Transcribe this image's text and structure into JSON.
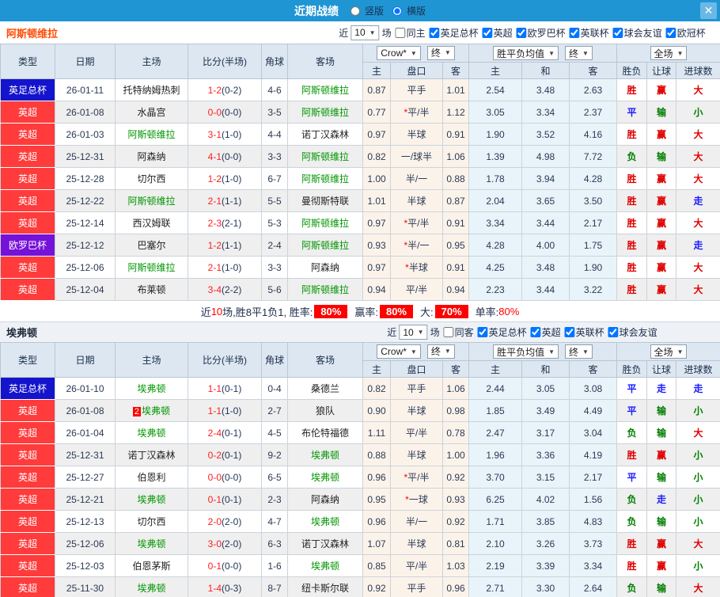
{
  "titlebar": {
    "title": "近期战绩",
    "radio_vertical": "竖版",
    "radio_horizontal": "横版",
    "close": "✕"
  },
  "table_header": {
    "type": "类型",
    "date": "日期",
    "home": "主场",
    "score": "比分(半场)",
    "corner": "角球",
    "away": "客场",
    "odds_select": "Crow*",
    "final_select": "终",
    "avg_select": "胜平负均值",
    "final_select2": "终",
    "scope_select": "全场",
    "sub_home": "主",
    "sub_handicap": "盘口",
    "sub_away": "客",
    "sub_win": "主",
    "sub_draw": "和",
    "sub_lose": "客",
    "sub_result": "胜负",
    "sub_hcp": "让球",
    "sub_goals": "进球数"
  },
  "competition_colors": {
    "英足总杯": "#1414cc",
    "英超": "#ff3b3b",
    "欧罗巴杯": "#7611d8"
  },
  "result_colors": {
    "胜": "#e00000",
    "平": "#1a1aff",
    "负": "#007d00",
    "赢": "#e00000",
    "走": "#1a1aff",
    "输": "#007d00",
    "大": "#e00000",
    "小": "#007d00"
  },
  "sections": [
    {
      "team": "阿斯顿维拉",
      "filter": {
        "near_label": "近",
        "count_value": "10",
        "games_label": "场",
        "venue_label": "同主",
        "venue_checked": false,
        "competitions": [
          "英足总杯",
          "英超",
          "欧罗巴杯",
          "英联杯",
          "球会友谊",
          "欧冠杯"
        ]
      },
      "rows": [
        {
          "comp": "英足总杯",
          "date": "26-01-11",
          "home": "托特纳姆热刺",
          "home_team": false,
          "badge": "",
          "score": "1-2",
          "half": "(0-2)",
          "corner": "4-6",
          "away": "阿斯顿维拉",
          "away_team": true,
          "h": "0.87",
          "hcp": "平手",
          "a": "1.01",
          "w": "2.54",
          "d": "3.48",
          "l": "2.63",
          "r1": "胜",
          "r2": "赢",
          "r3": "大"
        },
        {
          "comp": "英超",
          "date": "26-01-08",
          "home": "水晶宫",
          "home_team": false,
          "badge": "",
          "score": "0-0",
          "half": "(0-0)",
          "corner": "3-5",
          "away": "阿斯顿维拉",
          "away_team": true,
          "h": "0.77",
          "hcp": "*平/半",
          "a": "1.12",
          "w": "3.05",
          "d": "3.34",
          "l": "2.37",
          "r1": "平",
          "r2": "输",
          "r3": "小"
        },
        {
          "comp": "英超",
          "date": "26-01-03",
          "home": "阿斯顿维拉",
          "home_team": true,
          "badge": "",
          "score": "3-1",
          "half": "(1-0)",
          "corner": "4-4",
          "away": "诺丁汉森林",
          "away_team": false,
          "h": "0.97",
          "hcp": "半球",
          "a": "0.91",
          "w": "1.90",
          "d": "3.52",
          "l": "4.16",
          "r1": "胜",
          "r2": "赢",
          "r3": "大"
        },
        {
          "comp": "英超",
          "date": "25-12-31",
          "home": "阿森纳",
          "home_team": false,
          "badge": "",
          "score": "4-1",
          "half": "(0-0)",
          "corner": "3-3",
          "away": "阿斯顿维拉",
          "away_team": true,
          "h": "0.82",
          "hcp": "一/球半",
          "a": "1.06",
          "w": "1.39",
          "d": "4.98",
          "l": "7.72",
          "r1": "负",
          "r2": "输",
          "r3": "大"
        },
        {
          "comp": "英超",
          "date": "25-12-28",
          "home": "切尔西",
          "home_team": false,
          "badge": "",
          "score": "1-2",
          "half": "(1-0)",
          "corner": "6-7",
          "away": "阿斯顿维拉",
          "away_team": true,
          "h": "1.00",
          "hcp": "半/一",
          "a": "0.88",
          "w": "1.78",
          "d": "3.94",
          "l": "4.28",
          "r1": "胜",
          "r2": "赢",
          "r3": "大"
        },
        {
          "comp": "英超",
          "date": "25-12-22",
          "home": "阿斯顿维拉",
          "home_team": true,
          "badge": "",
          "score": "2-1",
          "half": "(1-1)",
          "corner": "5-5",
          "away": "曼彻斯特联",
          "away_team": false,
          "h": "1.01",
          "hcp": "半球",
          "a": "0.87",
          "w": "2.04",
          "d": "3.65",
          "l": "3.50",
          "r1": "胜",
          "r2": "赢",
          "r3": "走"
        },
        {
          "comp": "英超",
          "date": "25-12-14",
          "home": "西汉姆联",
          "home_team": false,
          "badge": "",
          "score": "2-3",
          "half": "(2-1)",
          "corner": "5-3",
          "away": "阿斯顿维拉",
          "away_team": true,
          "h": "0.97",
          "hcp": "*平/半",
          "a": "0.91",
          "w": "3.34",
          "d": "3.44",
          "l": "2.17",
          "r1": "胜",
          "r2": "赢",
          "r3": "大"
        },
        {
          "comp": "欧罗巴杯",
          "date": "25-12-12",
          "home": "巴塞尔",
          "home_team": false,
          "badge": "",
          "score": "1-2",
          "half": "(1-1)",
          "corner": "2-4",
          "away": "阿斯顿维拉",
          "away_team": true,
          "h": "0.93",
          "hcp": "*半/一",
          "a": "0.95",
          "w": "4.28",
          "d": "4.00",
          "l": "1.75",
          "r1": "胜",
          "r2": "赢",
          "r3": "走"
        },
        {
          "comp": "英超",
          "date": "25-12-06",
          "home": "阿斯顿维拉",
          "home_team": true,
          "badge": "",
          "score": "2-1",
          "half": "(1-0)",
          "corner": "3-3",
          "away": "阿森纳",
          "away_team": false,
          "h": "0.97",
          "hcp": "*半球",
          "a": "0.91",
          "w": "4.25",
          "d": "3.48",
          "l": "1.90",
          "r1": "胜",
          "r2": "赢",
          "r3": "大"
        },
        {
          "comp": "英超",
          "date": "25-12-04",
          "home": "布莱顿",
          "home_team": false,
          "badge": "",
          "score": "3-4",
          "half": "(2-2)",
          "corner": "5-6",
          "away": "阿斯顿维拉",
          "away_team": true,
          "h": "0.94",
          "hcp": "平/半",
          "a": "0.94",
          "w": "2.23",
          "d": "3.44",
          "l": "3.22",
          "r1": "胜",
          "r2": "赢",
          "r3": "大"
        }
      ],
      "summary": {
        "prefix": "近",
        "count": "10",
        "middle": "场,胜8平1负1, 胜率:",
        "items": [
          {
            "label": "",
            "value": "80%",
            "badge": true
          },
          {
            "label": "赢率:",
            "value": "80%",
            "badge": true
          },
          {
            "label": "大:",
            "value": "70%",
            "badge": true
          },
          {
            "label": "单率:",
            "value": "80%",
            "badge": false
          }
        ]
      }
    },
    {
      "team": "埃弗顿",
      "filter": {
        "near_label": "近",
        "count_value": "10",
        "games_label": "场",
        "venue_label": "同客",
        "venue_checked": false,
        "competitions": [
          "英足总杯",
          "英超",
          "英联杯",
          "球会友谊"
        ]
      },
      "rows": [
        {
          "comp": "英足总杯",
          "date": "26-01-10",
          "home": "埃弗顿",
          "home_team": true,
          "badge": "",
          "score": "1-1",
          "half": "(0-1)",
          "corner": "0-4",
          "away": "桑德兰",
          "away_team": false,
          "h": "0.82",
          "hcp": "平手",
          "a": "1.06",
          "w": "2.44",
          "d": "3.05",
          "l": "3.08",
          "r1": "平",
          "r2": "走",
          "r3": "走"
        },
        {
          "comp": "英超",
          "date": "26-01-08",
          "home": "埃弗顿",
          "home_team": true,
          "badge": "2",
          "score": "1-1",
          "half": "(1-0)",
          "corner": "2-7",
          "away": "狼队",
          "away_team": false,
          "h": "0.90",
          "hcp": "半球",
          "a": "0.98",
          "w": "1.85",
          "d": "3.49",
          "l": "4.49",
          "r1": "平",
          "r2": "输",
          "r3": "小"
        },
        {
          "comp": "英超",
          "date": "26-01-04",
          "home": "埃弗顿",
          "home_team": true,
          "badge": "",
          "score": "2-4",
          "half": "(0-1)",
          "corner": "4-5",
          "away": "布伦特福德",
          "away_team": false,
          "h": "1.11",
          "hcp": "平/半",
          "a": "0.78",
          "w": "2.47",
          "d": "3.17",
          "l": "3.04",
          "r1": "负",
          "r2": "输",
          "r3": "大"
        },
        {
          "comp": "英超",
          "date": "25-12-31",
          "home": "诺丁汉森林",
          "home_team": false,
          "badge": "",
          "score": "0-2",
          "half": "(0-1)",
          "corner": "9-2",
          "away": "埃弗顿",
          "away_team": true,
          "h": "0.88",
          "hcp": "半球",
          "a": "1.00",
          "w": "1.96",
          "d": "3.36",
          "l": "4.19",
          "r1": "胜",
          "r2": "赢",
          "r3": "小"
        },
        {
          "comp": "英超",
          "date": "25-12-27",
          "home": "伯恩利",
          "home_team": false,
          "badge": "",
          "score": "0-0",
          "half": "(0-0)",
          "corner": "6-5",
          "away": "埃弗顿",
          "away_team": true,
          "h": "0.96",
          "hcp": "*平/半",
          "a": "0.92",
          "w": "3.70",
          "d": "3.15",
          "l": "2.17",
          "r1": "平",
          "r2": "输",
          "r3": "小"
        },
        {
          "comp": "英超",
          "date": "25-12-21",
          "home": "埃弗顿",
          "home_team": true,
          "badge": "",
          "score": "0-1",
          "half": "(0-1)",
          "corner": "2-3",
          "away": "阿森纳",
          "away_team": false,
          "h": "0.95",
          "hcp": "*一球",
          "a": "0.93",
          "w": "6.25",
          "d": "4.02",
          "l": "1.56",
          "r1": "负",
          "r2": "走",
          "r3": "小"
        },
        {
          "comp": "英超",
          "date": "25-12-13",
          "home": "切尔西",
          "home_team": false,
          "badge": "",
          "score": "2-0",
          "half": "(2-0)",
          "corner": "4-7",
          "away": "埃弗顿",
          "away_team": true,
          "h": "0.96",
          "hcp": "半/一",
          "a": "0.92",
          "w": "1.71",
          "d": "3.85",
          "l": "4.83",
          "r1": "负",
          "r2": "输",
          "r3": "小"
        },
        {
          "comp": "英超",
          "date": "25-12-06",
          "home": "埃弗顿",
          "home_team": true,
          "badge": "",
          "score": "3-0",
          "half": "(2-0)",
          "corner": "6-3",
          "away": "诺丁汉森林",
          "away_team": false,
          "h": "1.07",
          "hcp": "半球",
          "a": "0.81",
          "w": "2.10",
          "d": "3.26",
          "l": "3.73",
          "r1": "胜",
          "r2": "赢",
          "r3": "大"
        },
        {
          "comp": "英超",
          "date": "25-12-03",
          "home": "伯恩茅斯",
          "home_team": false,
          "badge": "",
          "score": "0-1",
          "half": "(0-0)",
          "corner": "1-6",
          "away": "埃弗顿",
          "away_team": true,
          "h": "0.85",
          "hcp": "平/半",
          "a": "1.03",
          "w": "2.19",
          "d": "3.39",
          "l": "3.34",
          "r1": "胜",
          "r2": "赢",
          "r3": "小"
        },
        {
          "comp": "英超",
          "date": "25-11-30",
          "home": "埃弗顿",
          "home_team": true,
          "badge": "",
          "score": "1-4",
          "half": "(0-3)",
          "corner": "8-7",
          "away": "纽卡斯尔联",
          "away_team": false,
          "h": "0.92",
          "hcp": "平手",
          "a": "0.96",
          "w": "2.71",
          "d": "3.30",
          "l": "2.64",
          "r1": "负",
          "r2": "输",
          "r3": "大"
        }
      ]
    }
  ]
}
